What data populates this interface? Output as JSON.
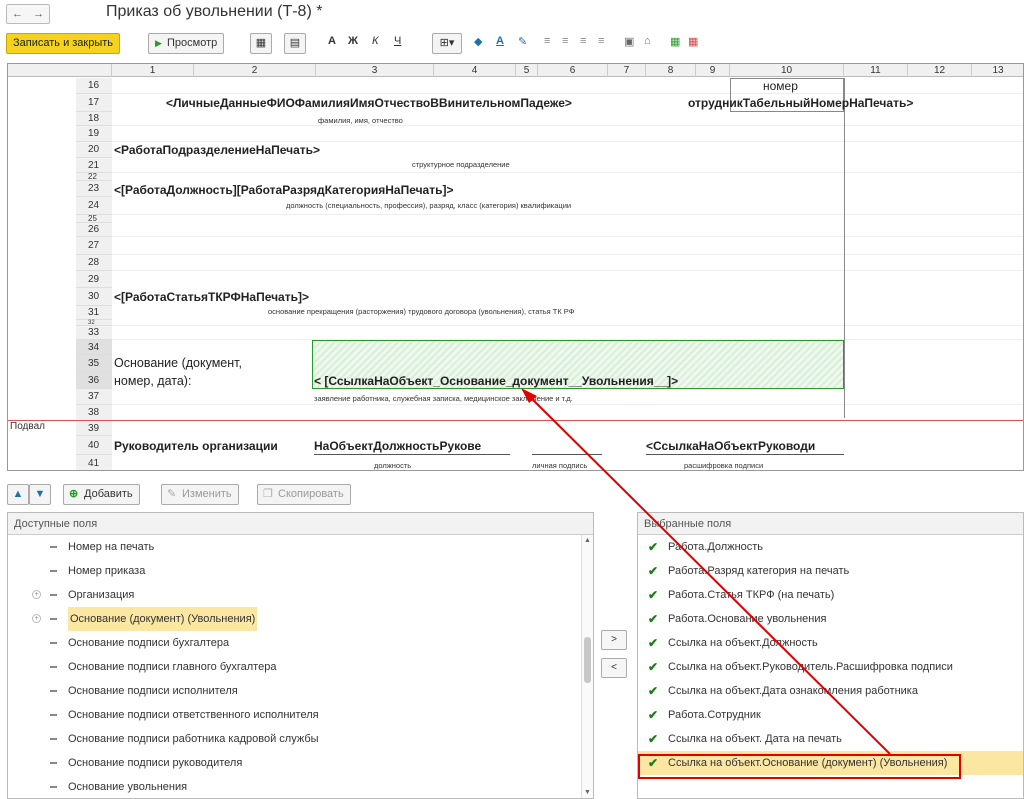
{
  "window": {
    "title": "Приказ об увольнении (Т-8) *",
    "back": "←",
    "forward": "→"
  },
  "toolbar": {
    "save_close": "Записать и закрыть",
    "preview": "Просмотр",
    "bold": "А",
    "italic_k": "Ж",
    "k2": "К",
    "underline": "Ч"
  },
  "sheet": {
    "columns": [
      "1",
      "2",
      "3",
      "4",
      "5",
      "6",
      "7",
      "8",
      "9",
      "10",
      "11",
      "12",
      "13"
    ],
    "rows": [
      "16",
      "17",
      "18",
      "19",
      "20",
      "21",
      "22",
      "23",
      "24",
      "25",
      "26",
      "27",
      "28",
      "29",
      "30",
      "31",
      "32",
      "33",
      "34",
      "35",
      "36",
      "37",
      "38",
      "39",
      "40",
      "41"
    ],
    "band_footer": "Подвал",
    "r16_number": "номер",
    "r17_fio": "<ЛичныеДанныеФИОФамилияИмяОтчествоВВинительномПадеже>",
    "r17_tab": "отрудникТабельныйНомерНаПечать>",
    "r18_caption": "фамилия, имя, отчество",
    "r20_dept": "<РаботаПодразделениеНаПечать>",
    "r21_caption": "структурное подразделение",
    "r23_position": "<[РаботаДолжность][РаботаРазрядКатегорияНаПечать]>",
    "r24_caption": "должность (специальность, профессия), разряд, класс (категория) квалификации",
    "r30_article": "<[РаботаСтатьяТКРФНаПечать]>",
    "r31_caption": "основание прекращения (расторжения) трудового договора (увольнения), статья ТК РФ",
    "r35_label": "Основание (документ,",
    "r36_label": "номер, дата):",
    "r36_field": "< [СсылкаНаОбъект_Основание_документ__Увольнения__]>",
    "r37_caption": "заявление работника, служебная записка, медицинское заключение и т.д.",
    "r40_head": "Руководитель организации",
    "r40_pos": "НаОбъектДолжностьРукове",
    "r40_sign": "<СсылкаНаОбъектРуководи",
    "r41_pos_caption": "должность",
    "r41_sign_caption": "личная подпись",
    "r41_decode_caption": "расшифровка  подписи"
  },
  "fields_toolbar": {
    "add": "Добавить",
    "edit": "Изменить",
    "copy": "Скопировать"
  },
  "available": {
    "header": "Доступные поля",
    "items": [
      {
        "label": "Номер на печать",
        "expandable": false,
        "selected": false
      },
      {
        "label": "Номер приказа",
        "expandable": false,
        "selected": false
      },
      {
        "label": "Организация",
        "expandable": true,
        "selected": false
      },
      {
        "label": "Основание (документ) (Увольнения)",
        "expandable": true,
        "selected": true
      },
      {
        "label": "Основание подписи бухгалтера",
        "expandable": false,
        "selected": false
      },
      {
        "label": "Основание подписи главного бухгалтера",
        "expandable": false,
        "selected": false
      },
      {
        "label": "Основание подписи исполнителя",
        "expandable": false,
        "selected": false
      },
      {
        "label": "Основание подписи ответственного исполнителя",
        "expandable": false,
        "selected": false
      },
      {
        "label": "Основание подписи работника кадровой службы",
        "expandable": false,
        "selected": false
      },
      {
        "label": "Основание подписи руководителя",
        "expandable": false,
        "selected": false
      },
      {
        "label": "Основание увольнения",
        "expandable": false,
        "selected": false
      }
    ]
  },
  "move": {
    "right": ">",
    "left": "<"
  },
  "chosen": {
    "header": "Выбранные поля",
    "items": [
      {
        "label": "Работа.Должность"
      },
      {
        "label": "Работа.Разряд категория на печать"
      },
      {
        "label": "Работа.Статья ТКРФ (на печать)"
      },
      {
        "label": "Работа.Основание увольнения"
      },
      {
        "label": "Ссылка на объект.Должность"
      },
      {
        "label": "Ссылка на объект.Руководитель.Расшифровка подписи"
      },
      {
        "label": "Ссылка на объект.Дата ознакомления работника"
      },
      {
        "label": "Работа.Сотрудник"
      },
      {
        "label": "Ссылка на объект. Дата на печать"
      },
      {
        "label": "Ссылка на объект.Основание (документ) (Увольнения)"
      }
    ]
  },
  "colors": {
    "accent": "#f4d21f",
    "highlight_box": "#e00000",
    "arrow": "#e00000",
    "green_frame": "#2a9a2a"
  }
}
